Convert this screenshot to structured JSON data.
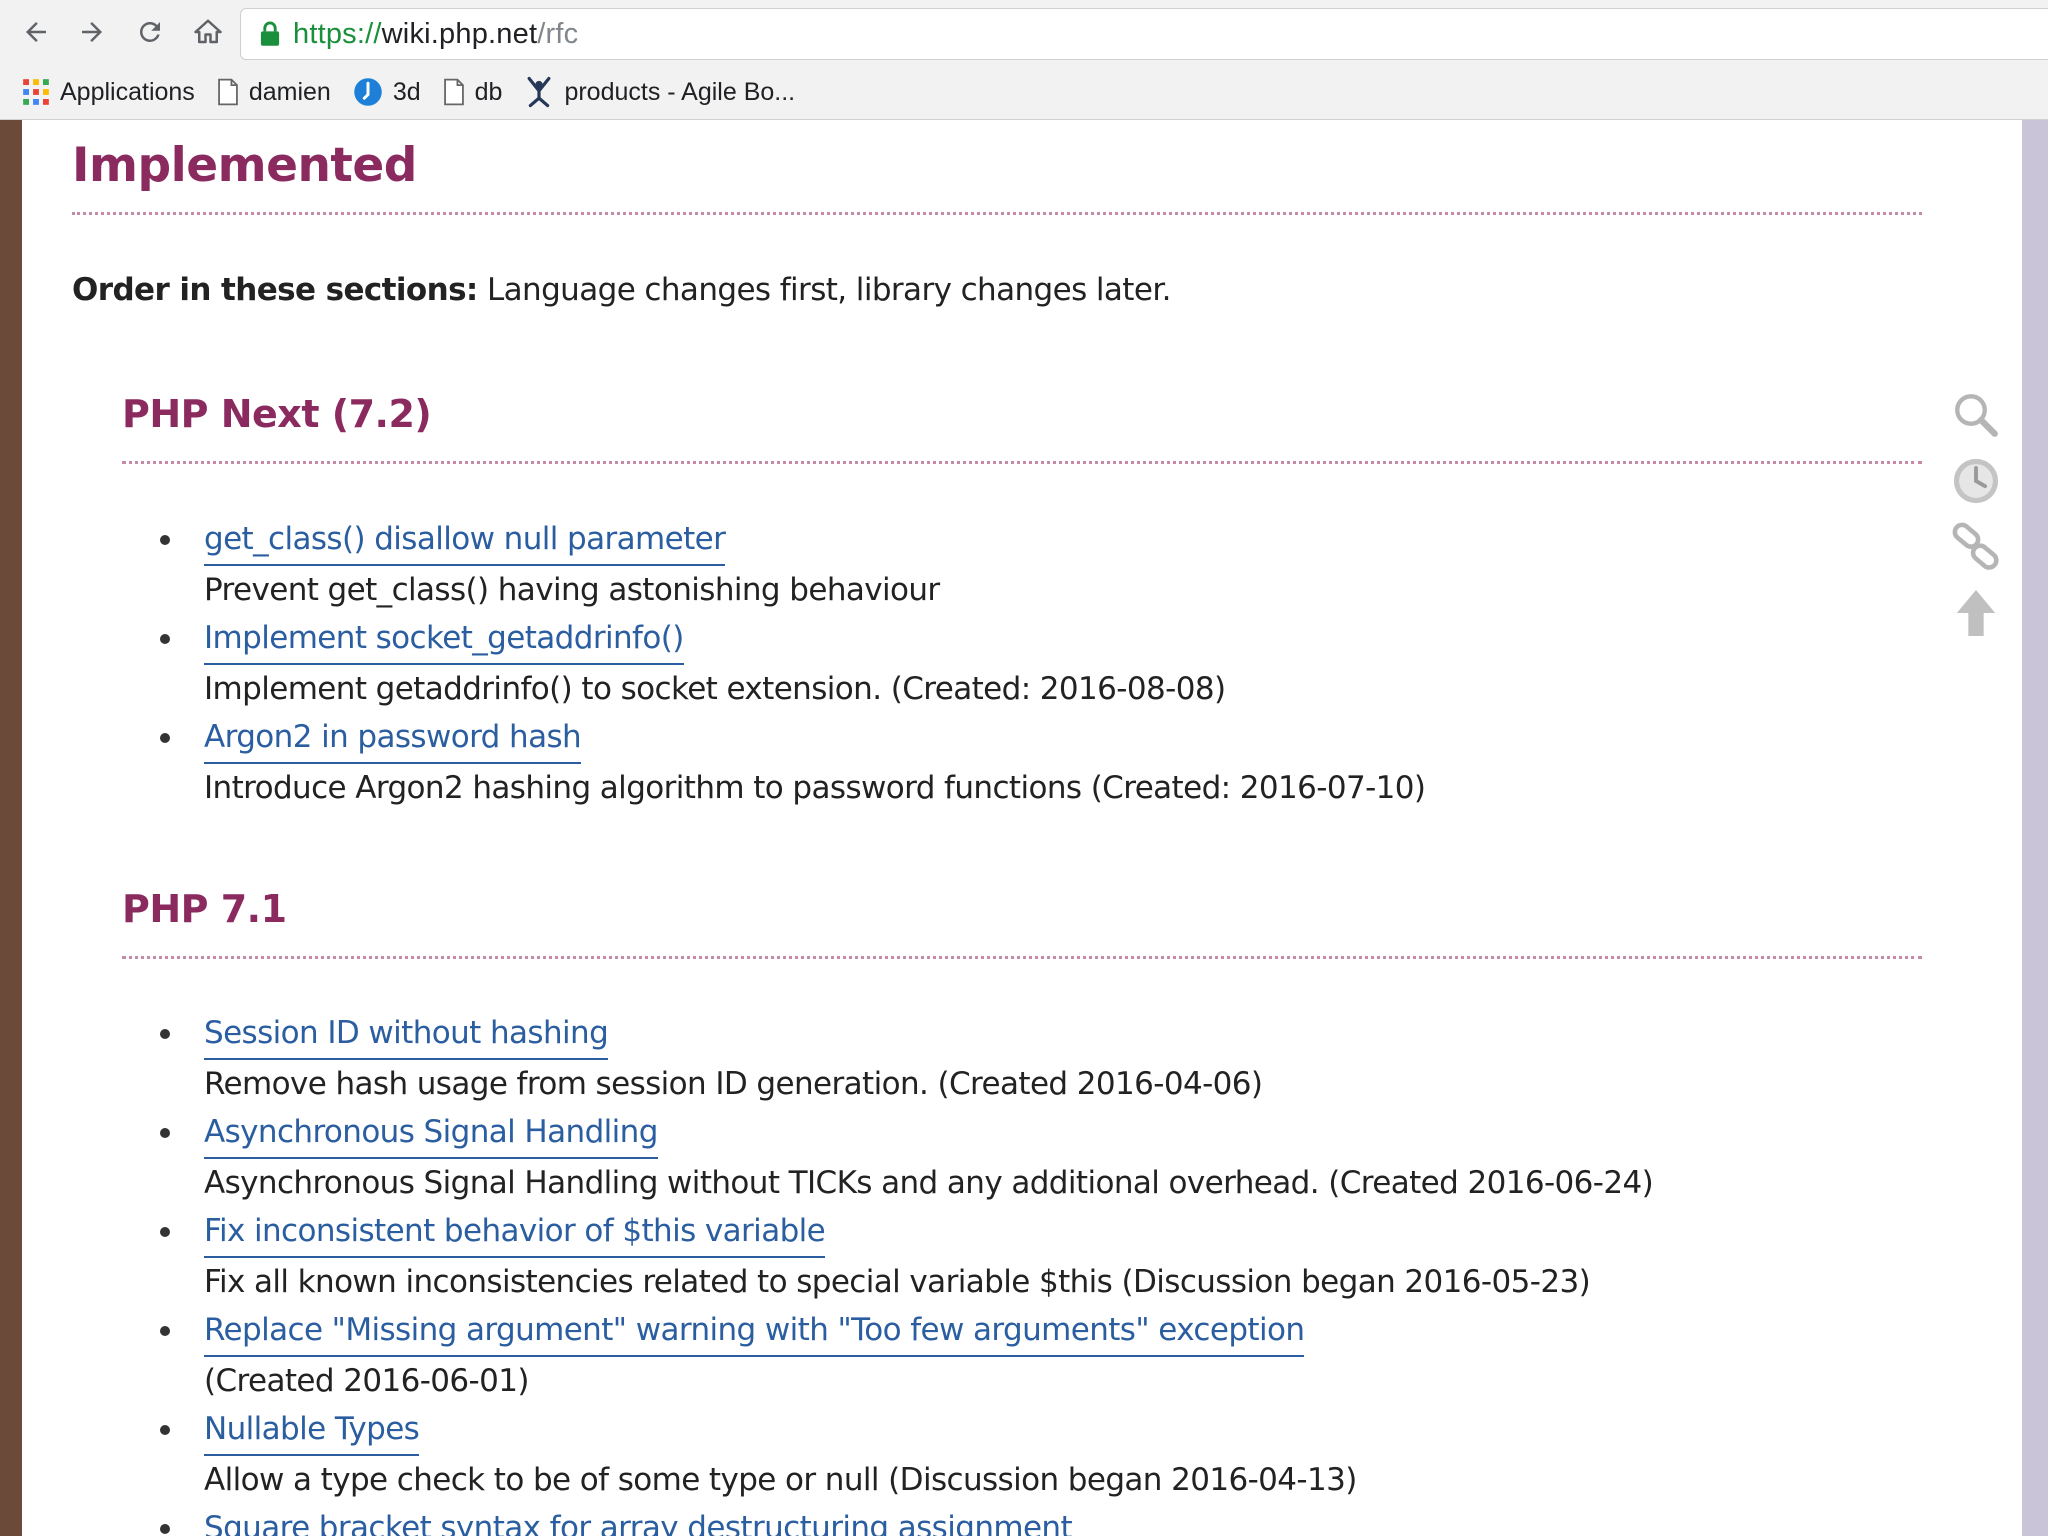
{
  "browser": {
    "url": {
      "scheme": "https://",
      "host": "wiki.php.net",
      "path": "/rfc"
    },
    "bookmarks": [
      {
        "label": "Applications",
        "icon": "apps-grid-icon"
      },
      {
        "label": "damien",
        "icon": "page-icon"
      },
      {
        "label": "3d",
        "icon": "blue-circle-icon"
      },
      {
        "label": "db",
        "icon": "page-icon"
      },
      {
        "label": "products - Agile Bo...",
        "icon": "agile-board-icon"
      }
    ]
  },
  "content": {
    "title": "Implemented",
    "order_label": "Order in these sections:",
    "order_text": " Language changes first, library changes later.",
    "sections": [
      {
        "heading": "PHP Next (7.2)",
        "items": [
          {
            "title": "get_class() disallow null parameter",
            "desc": "Prevent get_class() having astonishing behaviour"
          },
          {
            "title": "Implement socket_getaddrinfo()",
            "desc": "Implement getaddrinfo() to socket extension. (Created: 2016-08-08)"
          },
          {
            "title": "Argon2 in password hash",
            "desc": "Introduce Argon2 hashing algorithm to password functions (Created: 2016-07-10)"
          }
        ]
      },
      {
        "heading": "PHP 7.1",
        "items": [
          {
            "title": "Session ID without hashing",
            "desc": "Remove hash usage from session ID generation. (Created 2016-04-06)"
          },
          {
            "title": "Asynchronous Signal Handling",
            "desc": "Asynchronous Signal Handling without TICKs and any additional overhead. (Created 2016-06-24)"
          },
          {
            "title": "Fix inconsistent behavior of $this variable",
            "desc": "Fix all known inconsistencies related to special variable $this (Discussion began 2016-05-23)"
          },
          {
            "title": "Replace \"Missing argument\" warning with \"Too few arguments\" exception",
            "desc": "(Created 2016-06-01)"
          },
          {
            "title": "Nullable Types",
            "desc": "Allow a type check to be of some type or null (Discussion began 2016-04-13)"
          },
          {
            "title": "Square bracket syntax for array destructuring assignment",
            "desc": ""
          }
        ]
      }
    ]
  },
  "tools": [
    "search-icon",
    "clock-icon",
    "link-icon",
    "back-to-top-icon"
  ],
  "colors": {
    "heading": "#8a2a5e",
    "link": "#2b5ea0",
    "rule": "#c48aa8",
    "secure": "#1a8f3c"
  }
}
